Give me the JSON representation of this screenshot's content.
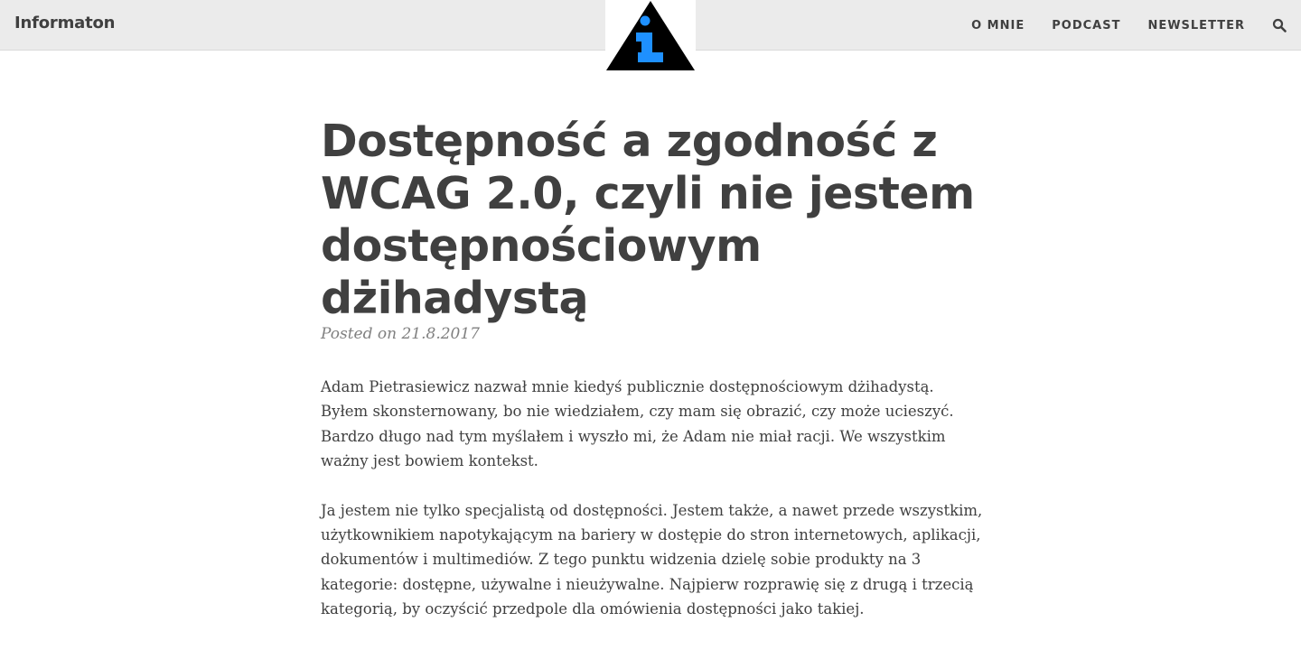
{
  "navbar": {
    "brand": "Informaton",
    "logo_icon": "info-triangle-icon",
    "links": [
      "O MNIE",
      "PODCAST",
      "NEWSLETTER"
    ],
    "search_icon": "search-icon"
  },
  "post": {
    "title": "Dostępność a zgodność z WCAG 2.0, czyli nie jestem dostępnościowym dżihadystą",
    "meta": "Posted on 21.8.2017",
    "paragraphs": [
      "Adam Pietrasiewicz nazwał mnie kiedyś publicznie dostępnościowym dżihadystą. Byłem skonsternowany, bo nie wiedziałem, czy mam się obrazić, czy może ucieszyć. Bardzo długo nad tym myślałem i wyszło mi, że Adam nie miał racji. We wszystkim ważny jest bowiem kontekst.",
      "Ja jestem nie tylko specjalistą od dostępności. Jestem także, a nawet przede wszystkim, użytkownikiem napotykającym na bariery w dostępie do stron internetowych, aplikacji, dokumentów i multimediów. Z tego punktu widzenia dzielę sobie produkty na 3 kategorie: dostępne, używalne i nieużywalne. Najpierw rozprawię się z drugą i trzecią kategorią, by oczyścić przedpole dla omówienia dostępności jako takiej."
    ]
  },
  "colors": {
    "navbar_bg": "#ebebeb",
    "text": "#404040",
    "meta": "#808080",
    "logo_accent": "#1e90ff"
  }
}
